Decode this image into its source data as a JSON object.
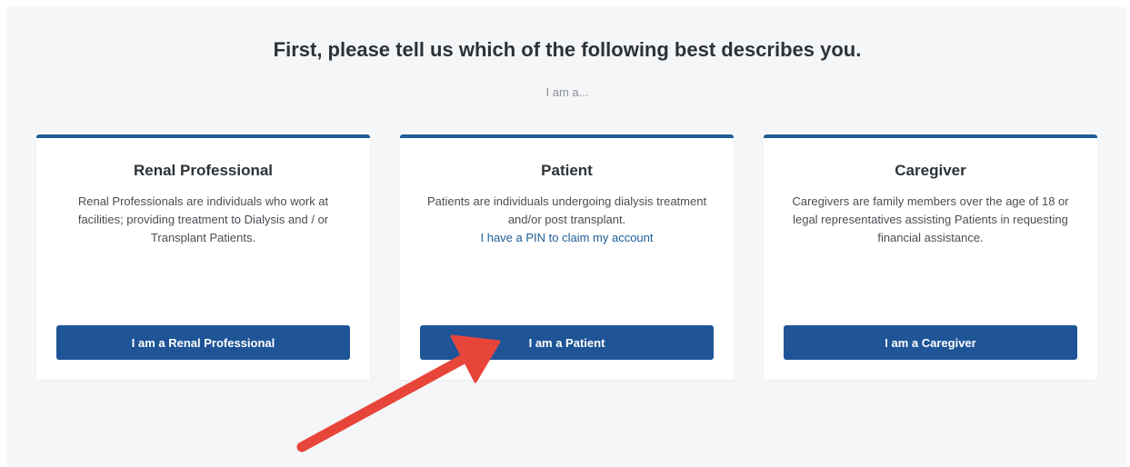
{
  "header": {
    "title": "First, please tell us which of the following best describes you.",
    "subtitle": "I am a..."
  },
  "cards": [
    {
      "title": "Renal Professional",
      "description": "Renal Professionals are individuals who work at facilities; providing treatment to Dialysis and / or Transplant Patients.",
      "button_label": "I am a Renal Professional"
    },
    {
      "title": "Patient",
      "description": "Patients are individuals undergoing dialysis treatment and/or post transplant.",
      "link_label": "I have a PIN to claim my account",
      "button_label": "I am a Patient"
    },
    {
      "title": "Caregiver",
      "description": "Caregivers are family members over the age of 18 or legal representatives assisting Patients in requesting financial assistance.",
      "button_label": "I am a Caregiver"
    }
  ],
  "colors": {
    "accent": "#1f5597",
    "card_border": "#1f5d97",
    "background": "#f5f6f8",
    "annotation_arrow": "#e8453a"
  },
  "annotation": {
    "icon": "arrow-pointer-icon"
  }
}
